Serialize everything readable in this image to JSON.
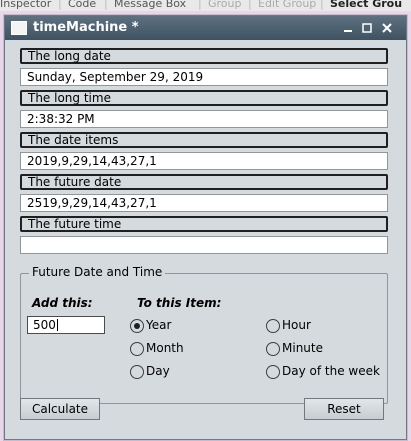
{
  "background_app": {
    "menu_items": [
      "Inspector",
      "Code",
      "Message Box",
      "Group",
      "Edit Group",
      "Select Grou"
    ]
  },
  "window": {
    "title": "timeMachine *",
    "controls": [
      "minimize",
      "maximize",
      "close"
    ]
  },
  "fields": [
    {
      "label": "The long date",
      "value": "Sunday, September 29, 2019"
    },
    {
      "label": "The long time",
      "value": "2:38:32 PM"
    },
    {
      "label": "The date items",
      "value": "2019,9,29,14,43,27,1"
    },
    {
      "label": "The future date",
      "value": "2519,9,29,14,43,27,1"
    },
    {
      "label": "The future time",
      "value": ""
    }
  ],
  "future_group": {
    "title": "Future Date and Time",
    "add_label": "Add this:",
    "to_label": "To this Item:",
    "amount": "500",
    "options": [
      {
        "label": "Year",
        "checked": true
      },
      {
        "label": "Month",
        "checked": false
      },
      {
        "label": "Day",
        "checked": false
      },
      {
        "label": "Hour",
        "checked": false
      },
      {
        "label": "Minute",
        "checked": false
      },
      {
        "label": "Day of the week",
        "checked": false
      }
    ]
  },
  "buttons": {
    "calculate": "Calculate",
    "reset": "Reset"
  }
}
